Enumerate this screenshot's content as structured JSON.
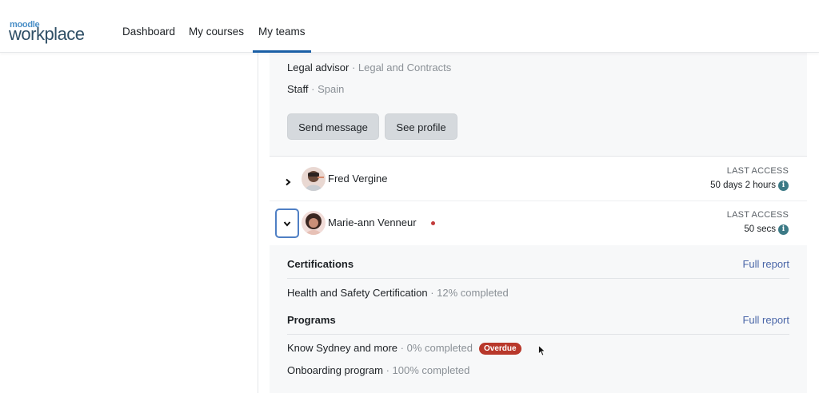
{
  "navbar": {
    "logo_small": "moodle",
    "logo_big": "workplace",
    "items": [
      {
        "label": "Dashboard",
        "active": false
      },
      {
        "label": "My courses",
        "active": false
      },
      {
        "label": "My teams",
        "active": true
      }
    ]
  },
  "expanded_member_top": {
    "job_title": "Legal advisor",
    "department": "Legal and Contracts",
    "position": "Staff",
    "location": "Spain",
    "separator": " · ",
    "buttons": {
      "send_message": "Send message",
      "see_profile": "See profile"
    }
  },
  "members": [
    {
      "name": "Fred Vergine",
      "expanded": false,
      "toggle_icon": "chevron-right-icon",
      "online": false,
      "last_access_label": "LAST ACCESS",
      "last_access_value": "50 days 2 hours",
      "info_icon": "i"
    },
    {
      "name": "Marie-ann Venneur",
      "expanded": true,
      "toggle_icon": "chevron-down-icon",
      "online": true,
      "status_color": "#c23b3b",
      "last_access_label": "LAST ACCESS",
      "last_access_value": "50 secs",
      "info_icon": "i"
    }
  ],
  "details": {
    "certifications": {
      "title": "Certifications",
      "full_report": "Full report",
      "items": [
        {
          "name": "Health and Safety Certification",
          "progress": "12% completed"
        }
      ]
    },
    "programs": {
      "title": "Programs",
      "full_report": "Full report",
      "items": [
        {
          "name": "Know Sydney and more",
          "progress": "0% completed",
          "badge": "Overdue"
        },
        {
          "name": "Onboarding program",
          "progress": "100% completed"
        }
      ]
    }
  },
  "colors": {
    "accent": "#1a5fa6",
    "link": "#4a66a8",
    "overdue_badge": "#b8382b",
    "info_icon": "#3c7a86"
  }
}
